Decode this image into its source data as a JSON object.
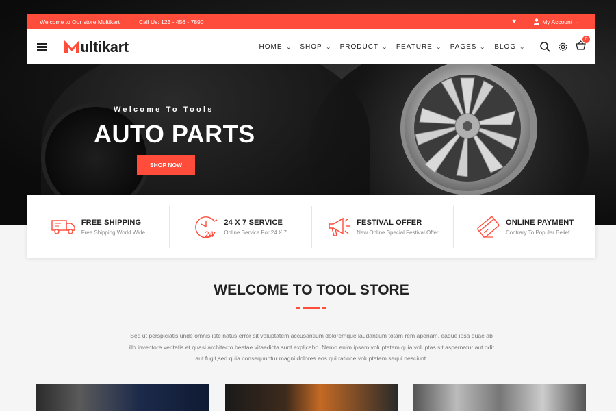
{
  "topbar": {
    "welcome": "Welcome to Our store Multikart",
    "phone": "Call Us: 123 - 456 - 7890",
    "account": "My Account"
  },
  "brand": {
    "name": "ultikart"
  },
  "menu": [
    {
      "label": "HOME"
    },
    {
      "label": "SHOP"
    },
    {
      "label": "PRODUCT"
    },
    {
      "label": "FEATURE"
    },
    {
      "label": "PAGES"
    },
    {
      "label": "BLOG"
    }
  ],
  "cart": {
    "count": "0"
  },
  "hero": {
    "subtitle": "Welcome To Tools",
    "title": "AUTO PARTS",
    "button": "SHOP NOW"
  },
  "services": [
    {
      "title": "FREE SHIPPING",
      "desc": "Free Shipping World Wide",
      "icon": "truck-icon"
    },
    {
      "title": "24 X 7 SERVICE",
      "desc": "Online Service For 24 X 7",
      "icon": "clock-24-icon"
    },
    {
      "title": "FESTIVAL OFFER",
      "desc": "New Online Special Festival Offer",
      "icon": "megaphone-icon"
    },
    {
      "title": "ONLINE PAYMENT",
      "desc": "Contrary To Popular Belief.",
      "icon": "card-icon"
    }
  ],
  "welcome": {
    "title": "WELCOME TO TOOL STORE",
    "text": "Sed ut perspiciatis unde omnis iste natus error sit voluptatem accusantium doloremque laudantium totam rem aperiam, eaque ipsa quae ab illo inventore veritatis et quasi architecto beatae vitaedicta sunt explicabo. Nemo enim ipsam voluptatem quia voluptas sit aspernatur aut odit aut fugit,sed quia consequuntur magni dolores eos qui ratione voluptatem sequi nesciunt."
  },
  "colors": {
    "accent": "#ff4c3b",
    "dark": "#222222"
  }
}
